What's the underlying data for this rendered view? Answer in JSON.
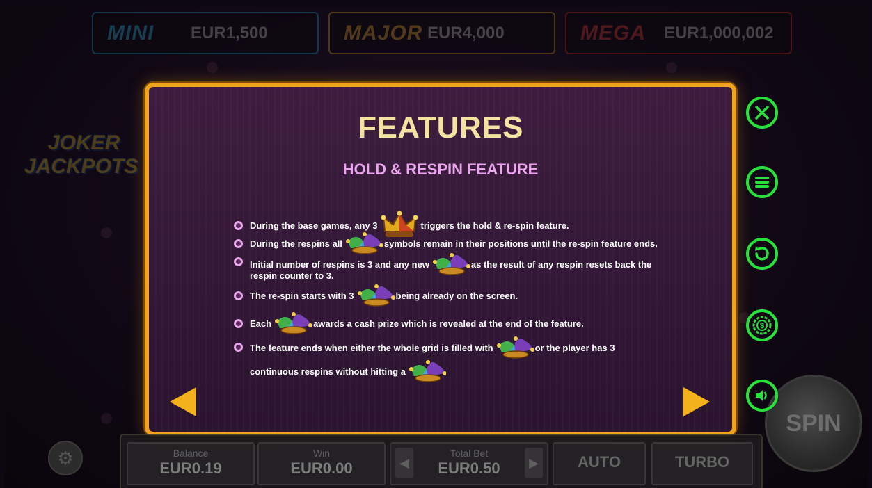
{
  "jackpots": [
    {
      "name": "MINI",
      "value": "EUR1,500",
      "color": "#3fc0ee"
    },
    {
      "name": "MAJOR",
      "value": "EUR4,000",
      "color": "#f0b33a"
    },
    {
      "name": "MEGA",
      "value": "EUR1,000,002",
      "color": "#e8483e"
    }
  ],
  "logo": {
    "line1": "JOKER",
    "line2": "JACKPOTS"
  },
  "dialog": {
    "title": "FEATURES",
    "subtitle": "HOLD & RESPIN FEATURE",
    "bullets": [
      {
        "before": "During the base games, any 3",
        "icon": "jester-crown-icon",
        "after": "triggers the hold & re-spin feature."
      },
      {
        "before": "During the respins all",
        "icon": "jester-hat-icon",
        "after": "symbols remain in their positions until the re-spin feature ends."
      },
      {
        "before": "Initial number of respins is 3 and any new",
        "icon": "jester-hat-icon",
        "after": "as the result of any respin resets back the",
        "line2": "respin counter to 3."
      },
      {
        "before": "The re-spin starts with 3",
        "icon": "jester-hat-icon",
        "after": "being already on the screen."
      },
      {
        "before": "Each",
        "icon": "jester-hat-icon",
        "after": "awards a cash prize which is revealed at the end of the feature."
      },
      {
        "before": "The feature ends when either the whole grid is filled with",
        "icon": "jester-hat-icon",
        "after": "or the player has 3",
        "line2_before": "continuous respins without hitting a",
        "line2_icon": "jester-hat-icon"
      }
    ]
  },
  "side_buttons": [
    "close-icon",
    "menu-icon",
    "history-icon",
    "coin-icon",
    "sound-icon"
  ],
  "spin": {
    "label": "SPIN"
  },
  "bottom": {
    "balance_label": "Balance",
    "balance_value": "EUR0.19",
    "win_label": "Win",
    "win_value": "EUR0.00",
    "bet_label": "Total Bet",
    "bet_value": "EUR0.50",
    "auto_label": "AUTO",
    "turbo_label": "TURBO"
  },
  "colors": {
    "accent_green": "#27e23a",
    "frame_orange": "#f2a31c",
    "title": "#f3e3a2",
    "subtitle": "#e9a6ec"
  }
}
